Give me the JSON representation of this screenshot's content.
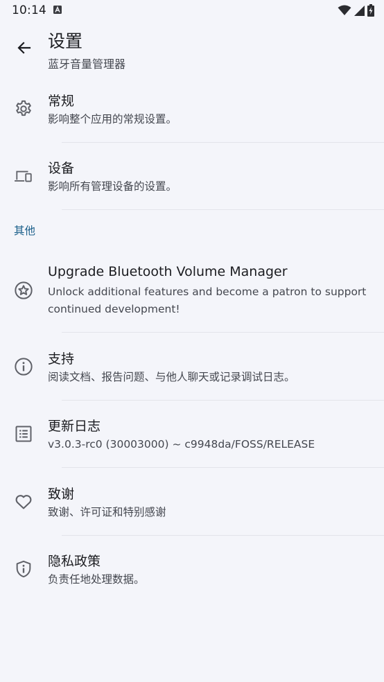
{
  "status_bar": {
    "time": "10:14",
    "notification_icon": "a-badge-icon",
    "wifi_icon": "wifi-icon",
    "signal_icon": "cell-signal-icon",
    "battery_icon": "battery-charging-icon"
  },
  "app_bar": {
    "back_icon": "arrow-back-icon",
    "title": "设置",
    "subtitle": "蓝牙音量管理器"
  },
  "general_items": [
    {
      "icon": "gear-icon",
      "title": "常规",
      "summary": "影响整个应用的常规设置。"
    },
    {
      "icon": "devices-icon",
      "title": "设备",
      "summary": "影响所有管理设备的设置。"
    }
  ],
  "other_section": {
    "header": "其他",
    "items": [
      {
        "icon": "star-badge-icon",
        "title": "Upgrade Bluetooth Volume Manager",
        "summary": "Unlock additional features and become a patron to support continued development!"
      },
      {
        "icon": "info-icon",
        "title": "支持",
        "summary": "阅读文档、报告问题、与他人聊天或记录调试日志。"
      },
      {
        "icon": "changelog-icon",
        "title": "更新日志",
        "summary": "v3.0.3-rc0 (30003000) ~ c9948da/FOSS/RELEASE"
      },
      {
        "icon": "heart-icon",
        "title": "致谢",
        "summary": "致谢、许可证和特别感谢"
      },
      {
        "icon": "shield-icon",
        "title": "隐私政策",
        "summary": "负责任地处理数据。"
      }
    ]
  },
  "colors": {
    "background": "#f4f5fa",
    "primary_text": "#1b1c20",
    "secondary_text": "#44474f",
    "accent": "#1a5f8a",
    "icon": "#5f6168"
  }
}
